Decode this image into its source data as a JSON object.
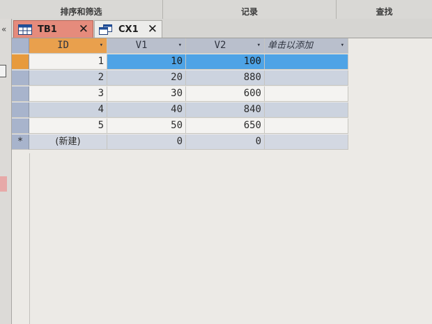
{
  "ribbon": {
    "groups": [
      "排序和筛选",
      "记录",
      "查找"
    ]
  },
  "nav": {
    "collapse_icon": "«"
  },
  "tabs": [
    {
      "label": "TB1",
      "icon": "table-icon",
      "close": "✕",
      "active": true
    },
    {
      "label": "CX1",
      "icon": "query-icon",
      "close": "✕",
      "active": false
    }
  ],
  "datasheet": {
    "columns": [
      "ID",
      "V1",
      "V2",
      "单击以添加"
    ],
    "dropdown_glyph": "▾",
    "rows": [
      {
        "ID": "1",
        "V1": "10",
        "V2": "100"
      },
      {
        "ID": "2",
        "V1": "20",
        "V2": "880"
      },
      {
        "ID": "3",
        "V1": "30",
        "V2": "600"
      },
      {
        "ID": "4",
        "V1": "40",
        "V2": "840"
      },
      {
        "ID": "5",
        "V1": "50",
        "V2": "650"
      }
    ],
    "new_row": {
      "marker": "*",
      "ID": "(新建)",
      "V1": "0",
      "V2": "0"
    }
  },
  "colors": {
    "active_tab": "#e58b7c",
    "selected_cell": "#4ea3e6",
    "header": "#b9bfcc",
    "selected_header": "#e9a04d"
  }
}
